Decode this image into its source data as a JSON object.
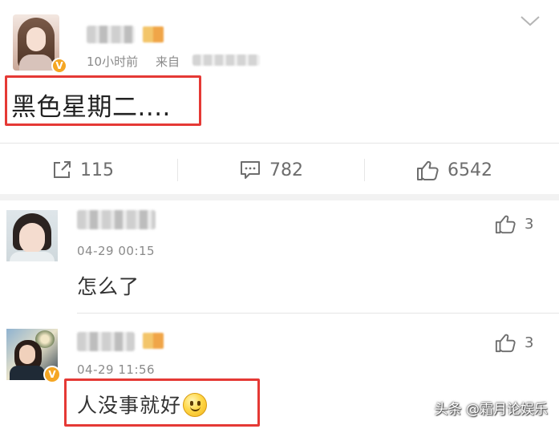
{
  "post": {
    "time": "10小时前",
    "source_prefix": "来自",
    "text": "黑色星期二....",
    "verified_mark": "V"
  },
  "actions": [
    {
      "icon": "share-icon",
      "count": "115"
    },
    {
      "icon": "comment-icon",
      "count": "782"
    },
    {
      "icon": "like-icon",
      "count": "6542"
    }
  ],
  "comments": [
    {
      "time": "04-29 00:15",
      "text": "怎么了",
      "likes": "3"
    },
    {
      "time": "04-29 11:56",
      "text": "人没事就好",
      "emoji": "smiley-emoji-icon",
      "likes": "3",
      "verified_mark": "V"
    }
  ],
  "watermark": "头条 @霜月论娱乐",
  "colors": {
    "highlight_box": "#e53935",
    "verified_badge": "#f5a623",
    "meta_text": "#8a8a8a",
    "divider": "#e6e6e6"
  }
}
